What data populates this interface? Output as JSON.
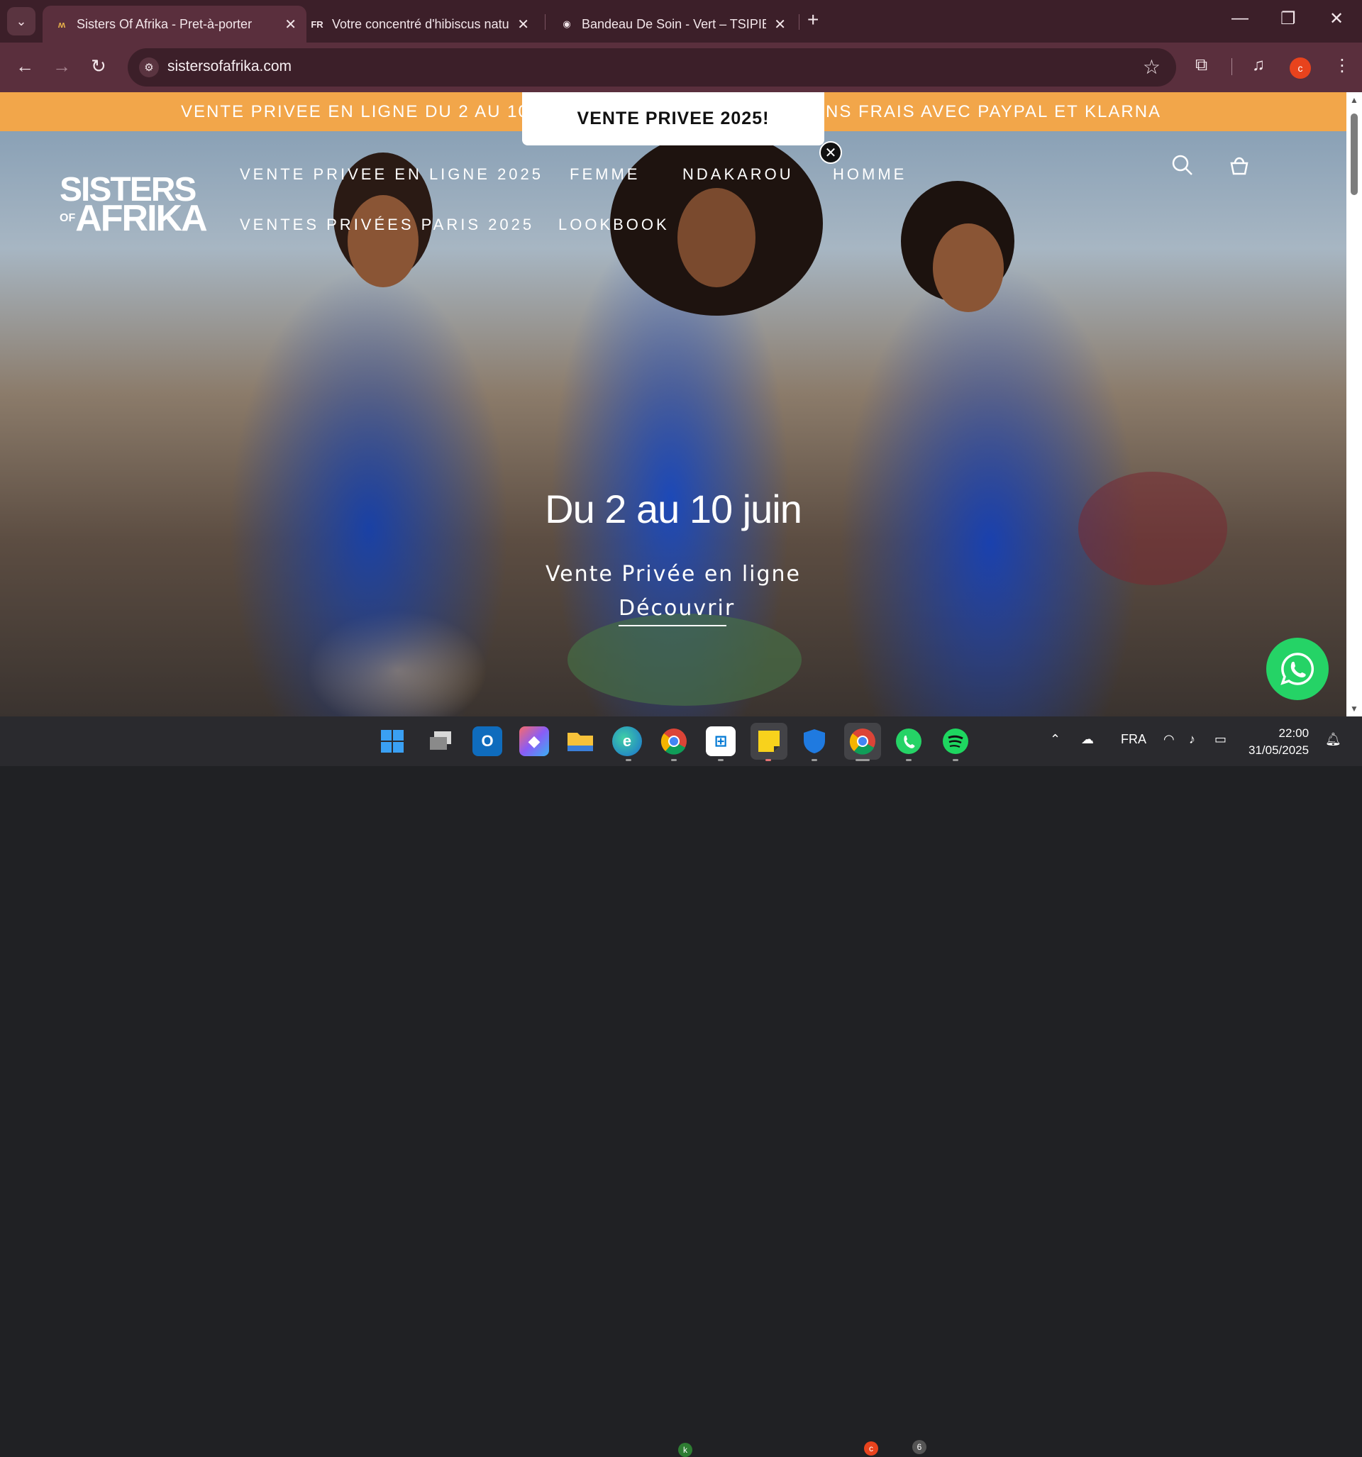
{
  "browser": {
    "tabs": [
      {
        "title": "Sisters Of Afrika - Pret-à-porter",
        "favicon": "sisters-of-afrika-favicon",
        "active": true
      },
      {
        "title": "Votre concentré d'hibiscus natu",
        "favicon": "FR",
        "active": false
      },
      {
        "title": "Bandeau De Soin - Vert – TSIPIE",
        "favicon": "tsipie-favicon",
        "active": false
      }
    ],
    "url": "sistersofafrika.com",
    "profile_initial": "c"
  },
  "page": {
    "promo_text_left": "VENTE PRIVEE EN LIGNE DU 2 AU 10",
    "promo_text_right": "NS FRAIS AVEC PAYPAL ET KLARNA",
    "popup_title": "VENTE PRIVEE 2025!",
    "logo_line1": "SISTERS",
    "logo_of": "OF",
    "logo_line2": "AFRIKA",
    "nav": [
      "VENTE PRIVEE EN LIGNE 2025",
      "FEMME",
      "NDAKAROU",
      "HOMME",
      "VENTES PRIVÉES PARIS 2025",
      "LOOKBOOK"
    ],
    "hero_title": "Du 2 au 10 juin",
    "hero_subtitle": "Vente Privée en ligne",
    "hero_cta": "Découvrir",
    "colors": {
      "promo_bar": "#f2a64a",
      "whatsapp": "#25d366",
      "chrome": "#5a2f3d"
    }
  },
  "taskbar": {
    "language": "FRA",
    "time": "22:00",
    "date": "31/05/2025",
    "whatsapp_badge": "6",
    "chrome_badge": "c",
    "chrome_k_badge": "k"
  }
}
